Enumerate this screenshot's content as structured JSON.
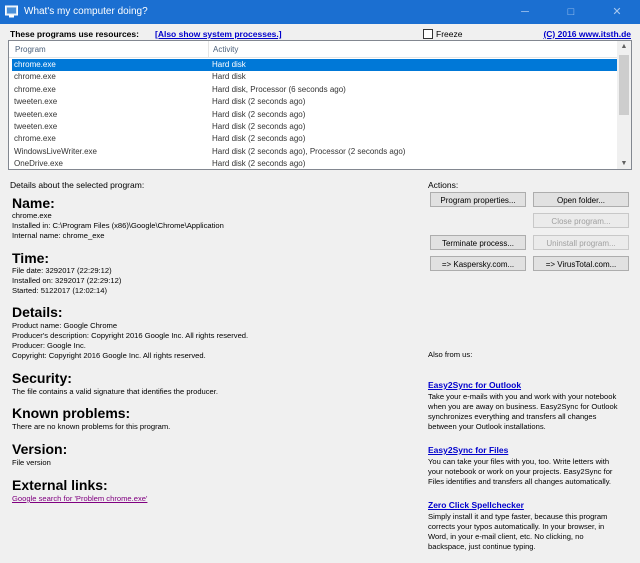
{
  "window": {
    "title": "What's my computer doing?"
  },
  "header": {
    "label": "These programs use resources:",
    "system_link": "[Also show system processes.]",
    "freeze_label": "Freeze",
    "copyright_link": "(C) 2016 www.itsth.de"
  },
  "list": {
    "columns": [
      "Program",
      "Activity"
    ],
    "rows": [
      {
        "program": "chrome.exe",
        "activity": "Hard disk"
      },
      {
        "program": "chrome.exe",
        "activity": "Hard disk"
      },
      {
        "program": "chrome.exe",
        "activity": "Hard disk, Processor (6 seconds ago)"
      },
      {
        "program": "tweeten.exe",
        "activity": "Hard disk (2 seconds ago)"
      },
      {
        "program": "tweeten.exe",
        "activity": "Hard disk (2 seconds ago)"
      },
      {
        "program": "tweeten.exe",
        "activity": "Hard disk (2 seconds ago)"
      },
      {
        "program": "chrome.exe",
        "activity": "Hard disk (2 seconds ago)"
      },
      {
        "program": "WindowsLiveWriter.exe",
        "activity": "Hard disk (2 seconds ago), Processor (2 seconds ago)"
      },
      {
        "program": "OneDrive.exe",
        "activity": "Hard disk (2 seconds ago)"
      }
    ]
  },
  "details": {
    "label": "Details about the selected program:",
    "name_heading": "Name:",
    "name_lines": [
      "chrome.exe",
      "Installed in: C:\\Program Files (x86)\\Google\\Chrome\\Application",
      "Internal name: chrome_exe"
    ],
    "time_heading": "Time:",
    "time_lines": [
      "File date: 3292017 (22:29:12)",
      "Installed on: 3292017 (22:29:12)",
      "Started: 5122017 (12:02:14)"
    ],
    "details_heading": "Details:",
    "details_lines": [
      "Product name: Google Chrome",
      "Producer's description: Copyright 2016 Google Inc. All rights reserved.",
      "Producer: Google Inc.",
      "Copyright: Copyright 2016 Google Inc. All rights reserved."
    ],
    "security_heading": "Security:",
    "security_text": "The file contains a valid signature that identifies the producer.",
    "problems_heading": "Known problems:",
    "problems_text": "There are no known problems for this program.",
    "version_heading": "Version:",
    "version_text": "File version",
    "links_heading": "External links:",
    "google_link": "Google search for 'Problem chrome.exe'"
  },
  "actions": {
    "label": "Actions:",
    "program_properties": "Program properties...",
    "open_folder": "Open folder...",
    "close_program": "Close program...",
    "terminate_process": "Terminate process...",
    "uninstall_program": "Uninstall program...",
    "kaspersky": "=> Kaspersky.com...",
    "virustotal": "=> VirusTotal.com..."
  },
  "promo": {
    "label": "Also from us:",
    "items": [
      {
        "title": "Easy2Sync for Outlook",
        "lines": [
          "Take your e-mails with you and work with your notebook",
          "when you are away on business. Easy2Sync for Outlook",
          "synchronizes everything and transfers all changes",
          "between your Outlook installations."
        ]
      },
      {
        "title": "Easy2Sync for Files",
        "lines": [
          "You can take your files with you, too. Write letters with",
          "your notebook or work on your projects. Easy2Sync for",
          "Files identifies and transfers all changes automatically."
        ]
      },
      {
        "title": "Zero Click Spellchecker",
        "lines": [
          "Simply install it and type faster, because this program",
          "corrects your typos automatically. In your browser, in",
          "Word, in your e-mail client, etc. No clicking, no",
          "backspace, just continue typing."
        ]
      }
    ]
  },
  "colors": {
    "titlebar": "#1b6fd1",
    "selection": "#0078d7",
    "link": "#0000cc",
    "visited_link": "#800080"
  },
  "icons": [
    "app-icon",
    "minimize-icon",
    "maximize-icon",
    "close-icon"
  ]
}
